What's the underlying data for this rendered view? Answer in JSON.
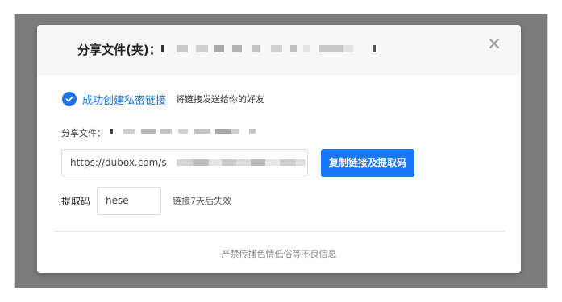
{
  "dialog": {
    "title": "分享文件(夹)：",
    "close_icon": "close-icon"
  },
  "status": {
    "icon": "check-circle-icon",
    "accent_color": "#1a73e8",
    "message": "成功创建私密链接",
    "hint": "将链接发送给你的好友"
  },
  "share": {
    "file_label": "分享文件：",
    "link_value": "https://dubox.com/s",
    "copy_button_label": "复制链接及提取码",
    "button_color": "#1677ff"
  },
  "extraction": {
    "label": "提取码",
    "code_value": "hese",
    "expiry_note": "链接7天后失效"
  },
  "footer": {
    "notice": "严禁传播色情低俗等不良信息"
  }
}
